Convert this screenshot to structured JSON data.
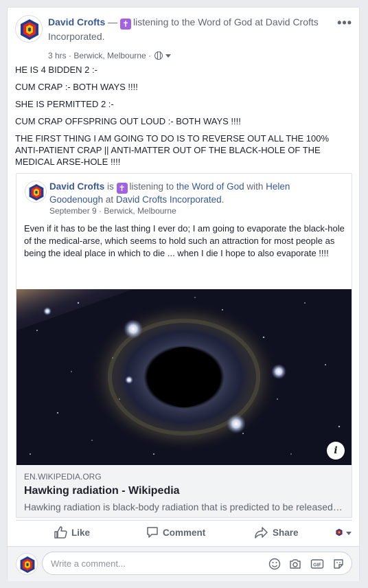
{
  "post": {
    "author": "David Crofts",
    "dash": " — ",
    "activity": "listening to the Word of God at David Crofts Incorporated.",
    "time": "3 hrs",
    "location": "Berwick, Melbourne",
    "sep": " · ",
    "body": [
      "HE IS 4 BIDDEN 2 :-",
      "CUM CRAP :- BOTH WAYS !!!!",
      "SHE IS PERMITTED 2 :-",
      "CUM CRAP OFFSPRING OUT LOUD :- BOTH WAYS !!!!",
      "THE FIRST THING I AM GOING TO DO IS TO REVERSE OUT ALL THE 100% ANTI-PATIENT CRAP || ANTI-MATTER OUT OF THE BLACK-HOLE OF THE MEDICAL ARSE-HOLE !!!!"
    ]
  },
  "shared": {
    "author": "David Crofts",
    "is": " is ",
    "listening": "listening to ",
    "object": "the Word of God",
    "with": " with ",
    "person": "Helen Goodenough",
    "at": " at ",
    "place": "David Crofts Incorporated",
    "period": ".",
    "date": "September 9",
    "location": "Berwick, Melbourne",
    "body": "Even if it has to be the last thing I ever do; I am going to evaporate the black-hole of the medical-arse, which seems to hold such an attraction for most people as being the ideal place in which to die ... when I die I hope to also evaporate !!!!"
  },
  "link": {
    "domain": "EN.WIKIPEDIA.ORG",
    "title": "Hawking radiation - Wikipedia",
    "description": "Hawking radiation is black-body radiation that is predicted to be released by black holes due to quantum effects"
  },
  "actions": {
    "like": "Like",
    "comment": "Comment",
    "share": "Share"
  },
  "comment_box": {
    "placeholder": "Write a comment..."
  },
  "icons": [
    "more-options-icon",
    "globe-icon",
    "activity-emoji-icon",
    "info-icon",
    "like-icon",
    "comment-icon",
    "share-icon",
    "emoji-icon",
    "camera-icon",
    "gif-icon",
    "sticker-icon"
  ],
  "colors": {
    "link": "#385898",
    "muted": "#606770",
    "activity": "#a362e0",
    "background": "#e9ebee"
  }
}
